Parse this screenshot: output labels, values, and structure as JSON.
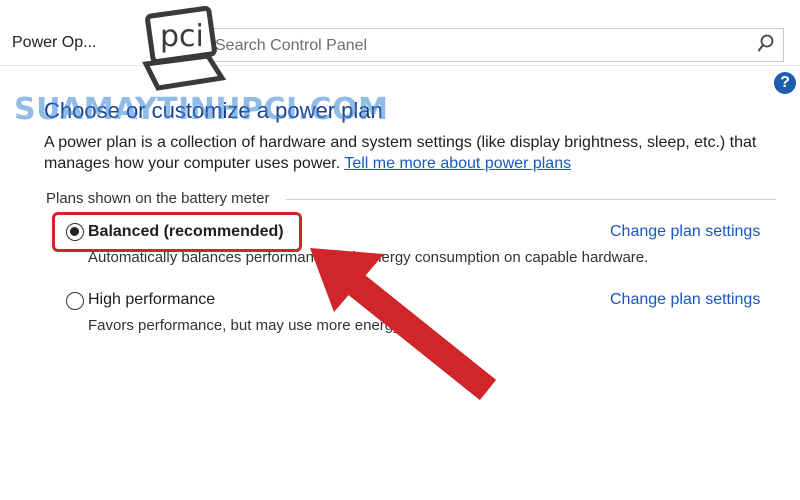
{
  "window": {
    "breadcrumb": "Power Op...",
    "search_placeholder": "Search Control Panel"
  },
  "watermark": {
    "text": "SUAMAYTINHPCI.COM",
    "logo_text": "pci"
  },
  "page": {
    "heading": "Choose or customize a power plan",
    "intro_text": "A power plan is a collection of hardware and system settings (like display brightness, sleep, etc.) that manages how your computer uses power.",
    "intro_link": "Tell me more about power plans"
  },
  "plans_group": {
    "title": "Plans shown on the battery meter",
    "plans": [
      {
        "label": "Balanced (recommended)",
        "description": "Automatically balances performance with energy consumption on capable hardware.",
        "change_link": "Change plan settings",
        "selected": true
      },
      {
        "label": "High performance",
        "description": "Favors performance, but may use more energy.",
        "change_link": "Change plan settings",
        "selected": false
      }
    ]
  },
  "colors": {
    "highlight": "#d0262a",
    "link": "#1a56c4",
    "heading": "#1c3f8c",
    "watermark": "#3a86d6"
  },
  "icons": {
    "refresh": "refresh-icon",
    "search": "search-icon",
    "help": "help-icon"
  }
}
